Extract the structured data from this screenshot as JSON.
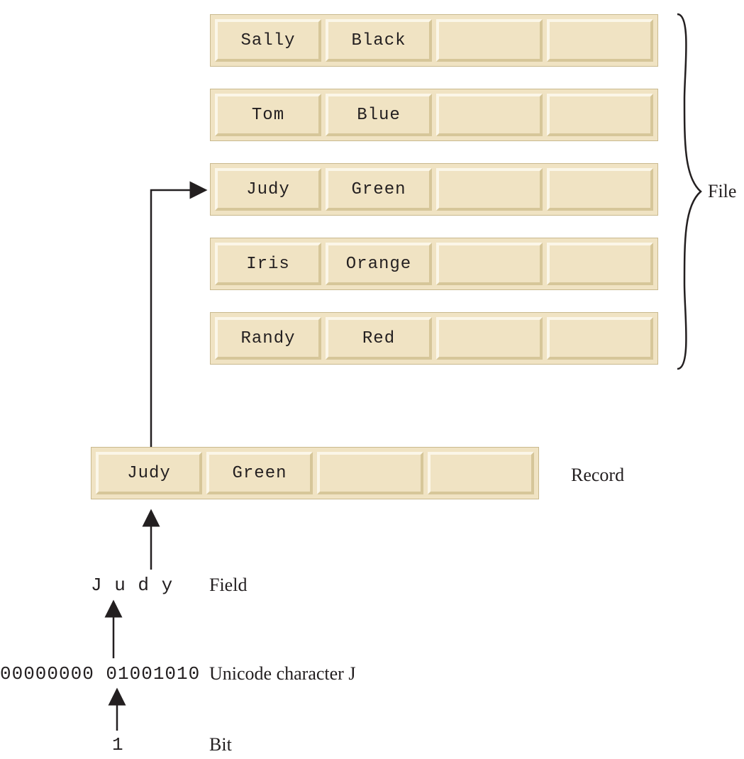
{
  "labels": {
    "file": "File",
    "record": "Record",
    "field": "Field",
    "unicode": "Unicode character J",
    "bit": "Bit"
  },
  "file_rows": [
    {
      "c0": "Sally",
      "c1": "Black",
      "c2": "",
      "c3": ""
    },
    {
      "c0": "Tom",
      "c1": "Blue",
      "c2": "",
      "c3": ""
    },
    {
      "c0": "Judy",
      "c1": "Green",
      "c2": "",
      "c3": ""
    },
    {
      "c0": "Iris",
      "c1": "Orange",
      "c2": "",
      "c3": ""
    },
    {
      "c0": "Randy",
      "c1": "Red",
      "c2": "",
      "c3": ""
    }
  ],
  "record_row": {
    "c0": "Judy",
    "c1": "Green",
    "c2": "",
    "c3": ""
  },
  "field_text": "J u d y",
  "unicode_text": "00000000 01001010",
  "bit_text": "1"
}
